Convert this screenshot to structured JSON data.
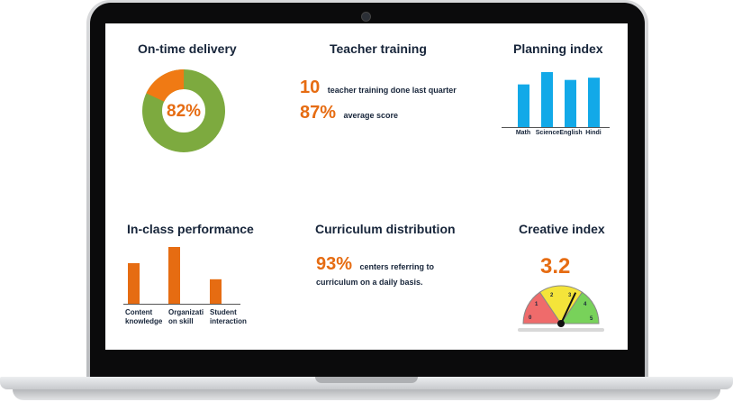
{
  "panels": {
    "ontime": {
      "title": "On-time delivery",
      "percent": "82%",
      "value": 0.82,
      "color_main": "#7daa3f",
      "color_rest": "#f07a14"
    },
    "teacher": {
      "title": "Teacher training",
      "stat1": {
        "value": "10",
        "text": "teacher training done last quarter"
      },
      "stat2": {
        "value": "87%",
        "text": "average score"
      }
    },
    "planning": {
      "title": "Planning index"
    },
    "inclass": {
      "title": "In-class performance"
    },
    "curriculum": {
      "title": "Curriculum  distribution",
      "value": "93%",
      "text1": "centers referring to",
      "text2": "curriculum on a daily basis."
    },
    "creative": {
      "title": "Creative index",
      "value": "3.2",
      "ticks": [
        "0",
        "1",
        "2",
        "3",
        "4",
        "5"
      ]
    }
  },
  "chart_data": [
    {
      "type": "bar",
      "title": "Planning index",
      "categories": [
        "Math",
        "Science",
        "English",
        "Hindi"
      ],
      "values": [
        0.78,
        1.0,
        0.86,
        0.9
      ],
      "color": "#12a9e8"
    },
    {
      "type": "bar",
      "title": "In-class performance",
      "categories": [
        "Content knowledge",
        "Organization skill",
        "Student interaction"
      ],
      "category_display": [
        [
          "Content",
          "knowledge"
        ],
        [
          "Organizati",
          "on skill"
        ],
        [
          "Student",
          "interaction"
        ]
      ],
      "values": [
        0.72,
        1.0,
        0.44
      ],
      "color": "#e66c12"
    }
  ]
}
